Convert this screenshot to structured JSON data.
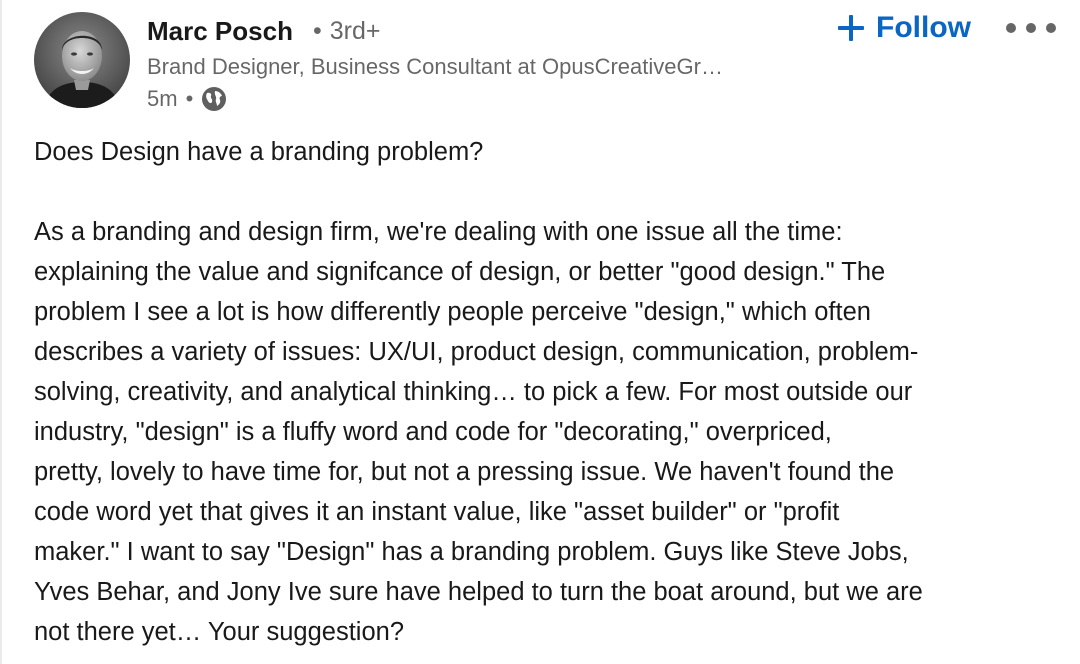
{
  "author": {
    "name": "Marc Posch",
    "degree_separator": "•",
    "degree": "3rd+",
    "headline": "Brand Designer, Business Consultant at OpusCreativeGr…",
    "time": "5m",
    "meta_separator": "•",
    "visibility_icon": "globe-icon",
    "avatar_icon": "profile-photo"
  },
  "actions": {
    "follow_icon": "plus-icon",
    "follow_label": "Follow",
    "more_icon": "ellipsis-icon"
  },
  "colors": {
    "accent": "#0a66c2",
    "text_primary": "#000000e6",
    "text_secondary": "#00000099"
  },
  "post": {
    "question": "Does Design have a branding problem?",
    "body_lines": [
      "As a branding and design firm, we're dealing with one issue all the time:",
      "explaining the value and signifcance of design, or better \"good design.\" The",
      "problem I see a lot is how differently people perceive \"design,\" which often",
      "describes a variety of issues: UX/UI, product design, communication, problem-",
      "solving, creativity, and analytical thinking… to pick a few. For most outside our",
      "industry, \"design\" is a fluffy word and code for \"decorating,\" overpriced,",
      "pretty, lovely to have time for, but not a pressing issue. We haven't found the",
      "code word yet that gives it an instant value, like \"asset builder\" or \"profit",
      "maker.\" I want to say \"Design\" has a branding problem. Guys like Steve Jobs,",
      "Yves Behar, and Jony Ive sure have helped to turn the boat around, but we are",
      "not there yet… Your suggestion?"
    ]
  }
}
